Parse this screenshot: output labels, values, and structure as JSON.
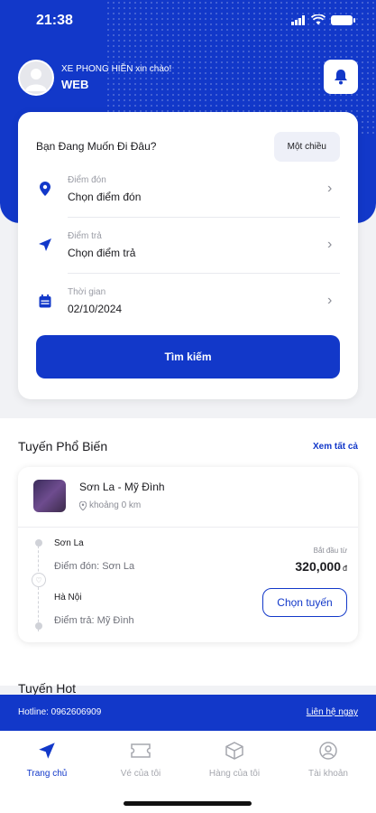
{
  "status_bar": {
    "time": "21:38"
  },
  "header": {
    "greeting": "XE PHONG HIỀN xin chào!",
    "user_name": "WEB"
  },
  "search": {
    "title": "Bạn Đang Muốn Đi Đâu?",
    "trip_type": "Một chiều",
    "pickup": {
      "label": "Điểm đón",
      "value": "Chọn điểm đón"
    },
    "dropoff": {
      "label": "Điểm trả",
      "value": "Chọn điểm trả"
    },
    "date": {
      "label": "Thời gian",
      "value": "02/10/2024"
    },
    "button": "Tìm kiếm"
  },
  "popular": {
    "title": "Tuyến Phổ Biến",
    "see_all": "Xem tất cả",
    "route": {
      "name": "Sơn La - Mỹ Đình",
      "distance": "khoảng 0 km",
      "from_city": "Sơn La",
      "from_point": "Điểm đón: Sơn La",
      "to_city": "Hà Nội",
      "to_point": "Điểm trả: Mỹ Đình",
      "from_price_label": "Bắt đầu từ",
      "price": "320,000",
      "currency": "đ",
      "choose": "Chọn tuyến"
    }
  },
  "hot": {
    "title": "Tuyến Hot"
  },
  "hotline": {
    "text": "Hotline: 0962606909",
    "contact": "Liên hệ ngay"
  },
  "tabs": [
    {
      "label": "Trang chủ",
      "icon": "send-icon"
    },
    {
      "label": "Vé của tôi",
      "icon": "ticket-icon"
    },
    {
      "label": "Hàng của tôi",
      "icon": "package-icon"
    },
    {
      "label": "Tài khoản",
      "icon": "user-icon"
    }
  ],
  "colors": {
    "primary": "#1238c9",
    "background": "#f1f2f5"
  }
}
